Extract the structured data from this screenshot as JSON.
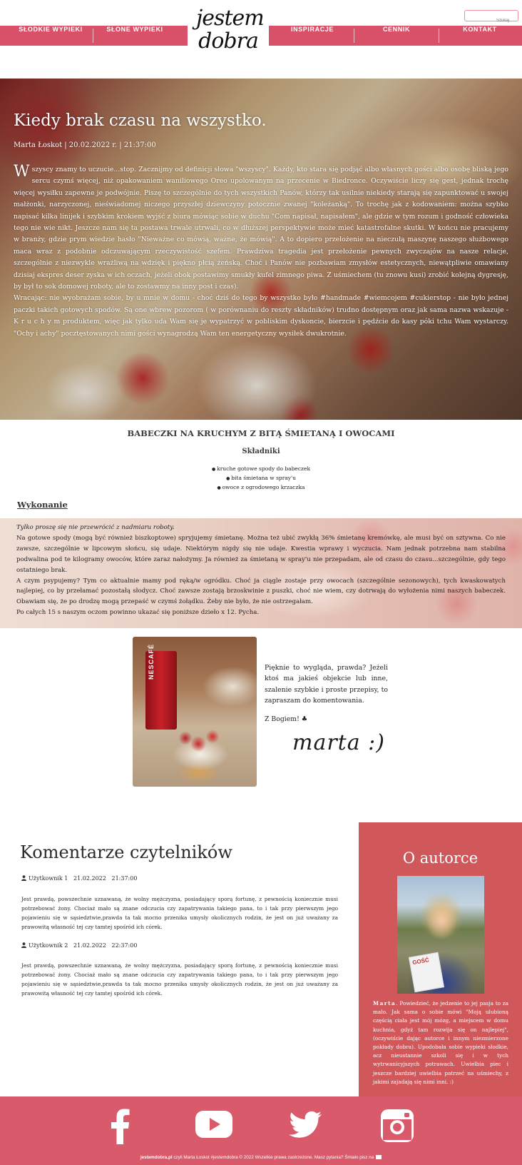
{
  "search": {
    "placeholder": "Szukaj"
  },
  "nav": {
    "items": [
      {
        "label": "SŁODKIE WYPIEKI"
      },
      {
        "label": "SŁONE WYPIEKI"
      },
      {
        "label": "INSPIRACJE"
      },
      {
        "label": "CENNIK"
      },
      {
        "label": "KONTAKT"
      }
    ],
    "logo_text": "jestem dobra"
  },
  "article": {
    "title": "Kiedy brak czasu na wszystko.",
    "meta": "Marta Łoskot | 20.02.2022 r. | 21:37:00",
    "dropcap": "W",
    "paragraph1": "szyscy znamy to uczucie...stop. Zacznijmy od definicji słowa \"wszyscy\". Każdy, kto stara się podjąć albo własnych gości albo osobę bliską jego sercu czymś więcej, niż opakowaniem waniliowego Oreo upolowanym na przecenie w Biedronce. Oczywiście liczy się gest, jednak trochę więcej wysiłku zapewne je podwójnie. Piszę to szczególnie do tych wszystkich Panów, którzy tak usilnie niekiedy starają się zapunktować u swojej małżonki, narzyczonej, nieświadomej niczego przyszłej dziewczyny potocznie zwanej \"koleżanką\". To trochę jak z kodowaniem: można szybko napisać kilka linijek i szybkim krokiem wyjść z biura mówiąc sobie w duchu \"Com napisał, napisałem\", ale gdzie w tym rozum i godność człowieka tego nie wie nikt. Jeszcze nam się ta postawa trwale utrwali, co w dłuższej perspektywie może mieć katastrofalne skutki. W końcu nie pracujemy w branży, gdzie prym wiedzie hasło \"Nieważne co mówią, ważne, że mówią\". A to dopiero przełożenie na nieczułą maszynę naszego służbowego maca wraz z podobnie odczuwającym rzeczywistość szefem. Prawdziwa tragedia jest przełożenie pewnych zwyczajów na nasze relacje, szczególnie z niezwykle wrażliwą na wdzięk i piękno płcią żeńską. Choć i Panów nie pozbawiam zmysłów estetycznych, niewątpliwie omawiany dzisiaj ekspres deser zyska w ich oczach, jeżeli obok postawimy smukły kufel zimnego piwa. Z uśmiechem (tu znowu kusi) zrobić kolejną dygresję, by był to sok domowej roboty, ale to zostawmy na inny post i czas).",
    "paragraph2": "Wracając: nie wyobrażam sobie, by u mnie w domu - choć dziś do tego by wszystko było #handmade #wiemcojem #cukierstop - nie było jednej paczki takich gotowych spodów. Są one wbrew pozorom ( w porównaniu do reszty składników) trudno dostępnym oraz jak sama nazwa wskazuje - K r u c h y m produktem, więc jak tylko uda Wam się je wypatrzyć w pobliskim dyskoncie, bierzcie i pędźcie do kasy póki tchu Wam wystarczy. \"Ochy i achy\" pocztęstowanych nimi gości wynagrodzą Wam ten energetyczny wysiłek dwukrotnie."
  },
  "recipe": {
    "title": "BABECZKI NA KRUCHYM Z BITĄ ŚMIETANĄ I OWOCAMI",
    "ingredients_heading": "Składniki",
    "ingredients": [
      "kruche gotowe spody do babeczek",
      "bita śmietana w spray'u",
      "owoce z ogrodowego krzaczka"
    ],
    "method_heading": "Wykonanie",
    "method_intro": "Tylko proszę się nie przewrócić z nadmiaru roboty.",
    "method_p1": "Na gotowe spody (mogą być również biszkoptowe) spryjujemy śmietanę. Można też ubić zwykłą 36% śmietanę kremówkę, ale musi być on sztywna. Co nie zawsze, szczególnie w lipcowym słońcu, się udaje. Niektórym nigdy się nie udaje. Kwestia wprawy i wyczucia. Nam jednak potrzebna nam stabilna podwalina pod te kilogramy owoców, które zaraz nałożymy. Ja również za śmietaną w spray'u nie przepadam, ale od czasu do czasu...szczególnie, gdy tego ostatniego brak.",
    "method_p2": "A czym psypujemy? Tym co aktualnie mamy pod ręką/w ogródku. Choć ja ciągle zostaje przy owocach (szczególnie sezonowych), tych kwaskowatych najlepiej, co by przełamać pozostałą słodycz. Choć zawsze zostają brzoskwinie z puszki, choć nie wiem, czy dotrwają do wyłożenia nimi naszych babeczek. Obawiam się, że po drodzę mogą przepaść w czymś żołądku. Żeby nie było, że nie ostrzegałam.",
    "method_p3": "Po całych 15 s naszym oczom powinno ukazać się poniższe dzieło x 12. Pycha."
  },
  "note": {
    "text": "Pięknie to wygląda, prawda? Jeżeli ktoś ma jakieś objekcie lub inne, szalenie szybkie i proste przepisy, to zapraszam do komentowania.",
    "sign": "Z Bogiem! ♣",
    "signature": "marta :)",
    "photo_label": "NESCAFÉ"
  },
  "comments": {
    "title": "Komentarze czytelników",
    "items": [
      {
        "user": "Użytkownik 1",
        "date": "21.02.2022",
        "time": "21:37:00",
        "body": "Jest prawdą, powszechnie uznawaną, że wolny mężczyzna, posiadający sporą fortunę, z pewnością koniecznie musi potrzebować żony. Chociaż mało są znane odczucia czy zapatrywania takiego pana, to i tak przy pierwszym jego pojawieniu się w sąsiedztwie,prawda ta tak mocno przenika umysły okolicznych rodzin, że jest on już uważany za prawowitą własność tej czy tamtej spośród ich córek."
      },
      {
        "user": "Użytkownik 2",
        "date": "21.02.2022",
        "time": "22:37:00",
        "body": "Jest prawdą, powszechnie uznawaną, że wolny mężczyzna, posiadający sporą fortunę, z pewnością koniecznie musi potrzebować żony. Chociaż mało są znane odczucia czy zapatrywania takiego pana, to i tak przy pierwszym jego pojawieniu się w sąsiedztwie,prawda ta tak mocno przenika umysły okolicznych rodzin, że jest on już uważany za prawowitą własność tej czy tamtej spośród ich córek."
      }
    ]
  },
  "author": {
    "title": "O autorce",
    "name": "Marta",
    "bio": ". Powiedzieć, że jedzenie to jej pasja to za mało. Jak sama o sobie mówi \"Moją ulubioną częścią ciała jest mój mózg, a miejscem w domu kuchnia, gdyż tam rozwija się on najlepiej\", (oczywiście dając autorce i innym niezmierzone pokłady dobra). Upodobała sobie wypieki słodkie, acz nieustannie szkoli się i w tych wytrwanicyjszych potrawach. Uwielbia piec i jeszcze bardziej uwielbia patrzeć na uśmiechy, z jakimi zajadają się nimi inni. :)",
    "magazine_label": "GOŚĆ"
  },
  "social": [
    "facebook-icon",
    "youtube-icon",
    "twitter-icon",
    "instagram-icon"
  ],
  "footer": {
    "site": "jestemdobra.pl",
    "text": " czyli Marta Łoskot #jestemdobra © 2022 Wszelkie prawa zastrzeżone. Masz pytania? Śmiało pisz na"
  },
  "colors": {
    "brand": "#d95168",
    "author_bg": "#d0585b",
    "footer_bg": "#d95a6b"
  }
}
